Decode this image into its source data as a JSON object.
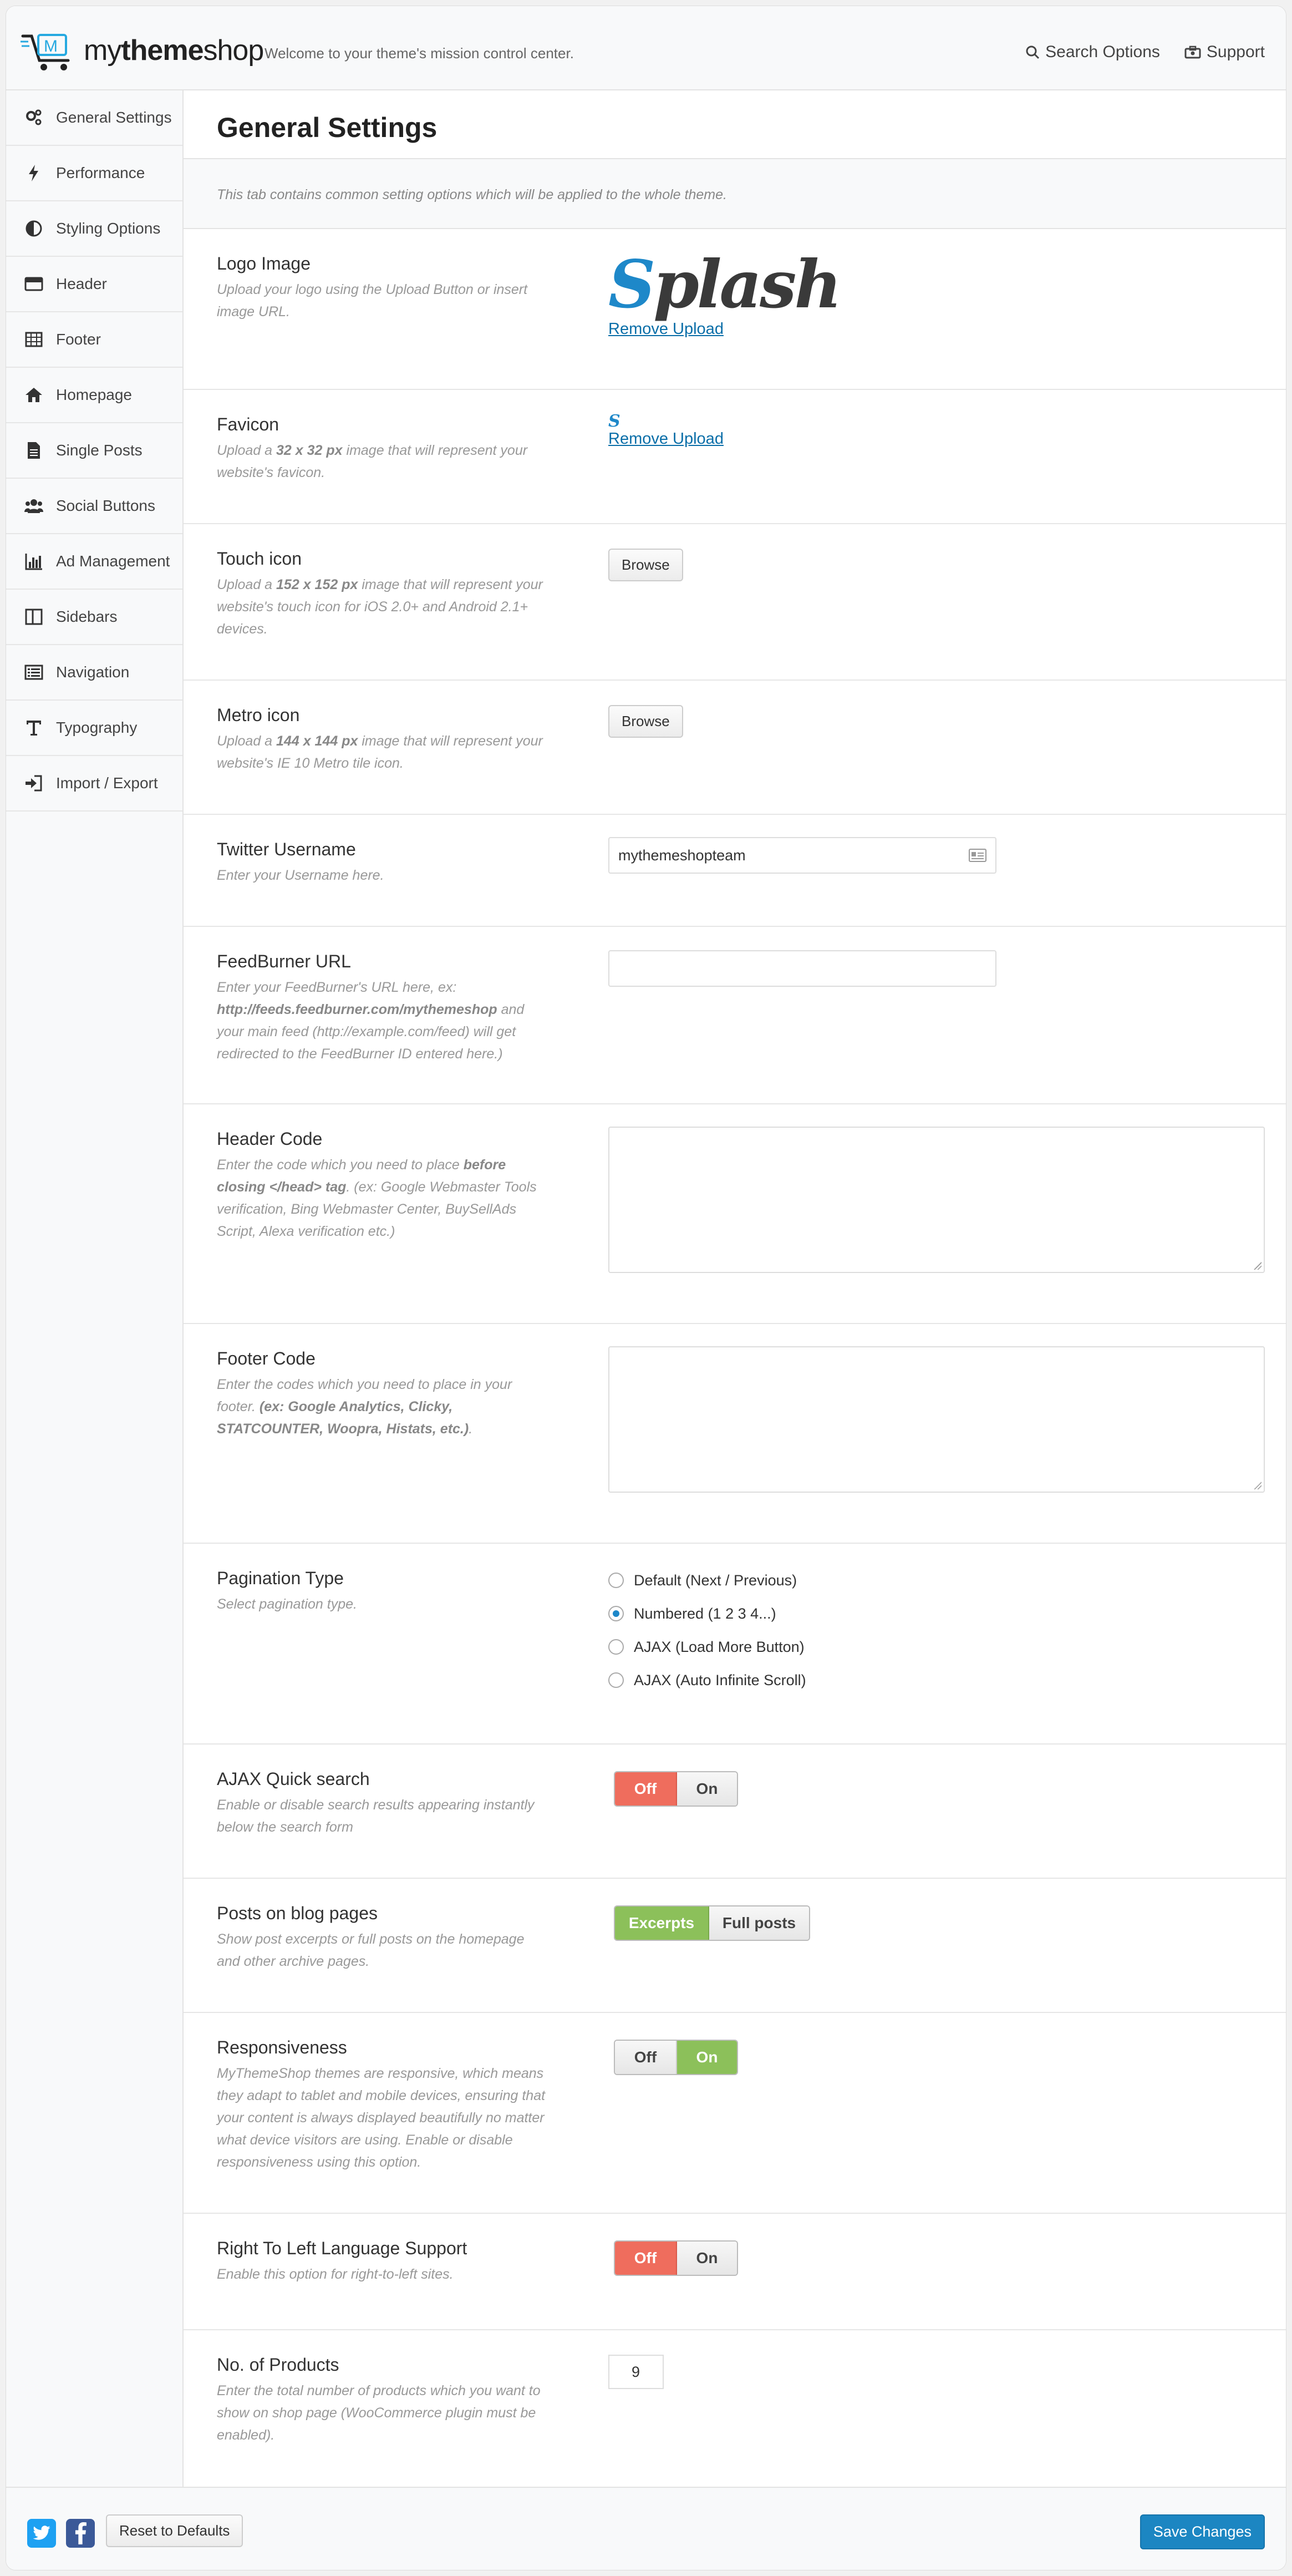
{
  "header": {
    "logo_text_light": "my",
    "logo_text_bold": "theme",
    "logo_text_end": "shop",
    "welcome": "Welcome to your theme's mission control center.",
    "search_options": "Search Options",
    "support": "Support"
  },
  "sidebar": {
    "items": [
      {
        "label": "General Settings",
        "icon": "gears-icon"
      },
      {
        "label": "Performance",
        "icon": "bolt-icon"
      },
      {
        "label": "Styling Options",
        "icon": "contrast-icon"
      },
      {
        "label": "Header",
        "icon": "header-icon"
      },
      {
        "label": "Footer",
        "icon": "table-icon"
      },
      {
        "label": "Homepage",
        "icon": "home-icon"
      },
      {
        "label": "Single Posts",
        "icon": "document-icon"
      },
      {
        "label": "Social Buttons",
        "icon": "users-icon"
      },
      {
        "label": "Ad Management",
        "icon": "bar-chart-icon"
      },
      {
        "label": "Sidebars",
        "icon": "columns-icon"
      },
      {
        "label": "Navigation",
        "icon": "list-icon"
      },
      {
        "label": "Typography",
        "icon": "text-icon"
      },
      {
        "label": "Import / Export",
        "icon": "sign-in-icon"
      }
    ]
  },
  "main": {
    "title": "General Settings",
    "intro": "This tab contains common setting options which will be applied to the whole theme.",
    "logo": {
      "title": "Logo Image",
      "desc": "Upload your logo using the Upload Button or insert image URL.",
      "image_first": "S",
      "image_rest": "plash",
      "remove": "Remove Upload"
    },
    "favicon": {
      "title": "Favicon",
      "desc_1": "Upload a ",
      "desc_b": "32 x 32 px",
      "desc_2": " image that will represent your website's favicon.",
      "remove": "Remove Upload"
    },
    "touch": {
      "title": "Touch icon",
      "desc_1": "Upload a ",
      "desc_b": "152 x 152 px",
      "desc_2": " image that will represent your website's touch icon for iOS 2.0+ and Android 2.1+ devices.",
      "browse": "Browse"
    },
    "metro": {
      "title": "Metro icon",
      "desc_1": "Upload a ",
      "desc_b": "144 x 144 px",
      "desc_2": " image that will represent your website's IE 10 Metro tile icon.",
      "browse": "Browse"
    },
    "twitter": {
      "title": "Twitter Username",
      "desc": "Enter your Username here.",
      "value": "mythemeshopteam"
    },
    "feedburner": {
      "title": "FeedBurner URL",
      "desc_1": "Enter your FeedBurner's URL here, ex: ",
      "desc_b": "http://feeds.feedburner.com/mythemeshop",
      "desc_2": " and your main feed (http://example.com/feed) will get redirected to the FeedBurner ID entered here.)",
      "value": ""
    },
    "header_code": {
      "title": "Header Code",
      "desc_1": "Enter the code which you need to place ",
      "desc_b": "before closing </head> tag",
      "desc_2": ". (ex: Google Webmaster Tools verification, Bing Webmaster Center, BuySellAds Script, Alexa verification etc.)"
    },
    "footer_code": {
      "title": "Footer Code",
      "desc_1": "Enter the codes which you need to place in your footer. ",
      "desc_b": "(ex: Google Analytics, Clicky, STATCOUNTER, Woopra, Histats, etc.)",
      "desc_2": "."
    },
    "pagination": {
      "title": "Pagination Type",
      "desc": "Select pagination type.",
      "options": [
        "Default (Next / Previous)",
        "Numbered (1 2 3 4...)",
        "AJAX (Load More Button)",
        "AJAX (Auto Infinite Scroll)"
      ],
      "selected": "Numbered (1 2 3 4...)"
    },
    "ajax_search": {
      "title": "AJAX Quick search",
      "desc": "Enable or disable search results appearing instantly below the search form",
      "off": "Off",
      "on": "On",
      "value": "Off"
    },
    "posts": {
      "title": "Posts on blog pages",
      "desc": "Show post excerpts or full posts on the homepage and other archive pages.",
      "a": "Excerpts",
      "b": "Full posts",
      "value": "Excerpts"
    },
    "responsive": {
      "title": "Responsiveness",
      "desc": "MyThemeShop themes are responsive, which means they adapt to tablet and mobile devices, ensuring that your content is always displayed beautifully no matter what device visitors are using. Enable or disable responsiveness using this option.",
      "off": "Off",
      "on": "On",
      "value": "On"
    },
    "rtl": {
      "title": "Right To Left Language Support",
      "desc": "Enable this option for right-to-left sites.",
      "off": "Off",
      "on": "On",
      "value": "Off"
    },
    "products": {
      "title": "No. of Products",
      "desc": "Enter the total number of products which you want to show on shop page (WooCommerce plugin must be enabled).",
      "value": "9"
    }
  },
  "footer": {
    "reset": "Reset to Defaults",
    "save": "Save Changes"
  },
  "colors": {
    "accent": "#1e88c9",
    "off_red": "#ef6d5d",
    "on_green": "#8cc05a",
    "twitter": "#1da1f2",
    "facebook": "#3b5998"
  }
}
